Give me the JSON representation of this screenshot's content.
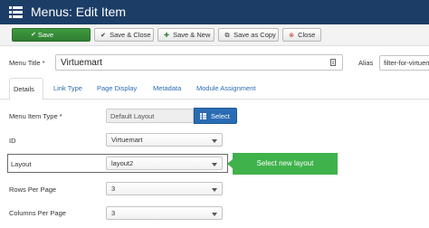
{
  "header": {
    "title": "Menus: Edit Item",
    "icon": "menu-list-icon"
  },
  "toolbar": {
    "save_label": "Save",
    "save_close_label": "Save & Close",
    "save_new_label": "Save & New",
    "save_copy_label": "Save as Copy",
    "close_label": "Close"
  },
  "form": {
    "menu_title_label": "Menu Title *",
    "menu_title_value": "Virtuemart",
    "alias_label": "Alias",
    "alias_value": "filter-for-virtuemart"
  },
  "tabs": [
    {
      "label": "Details",
      "active": true
    },
    {
      "label": "Link Type"
    },
    {
      "label": "Page Display"
    },
    {
      "label": "Metadata"
    },
    {
      "label": "Module Assignment"
    }
  ],
  "fields": {
    "menu_item_type_label": "Menu Item Type *",
    "menu_item_type_value": "Default Layout",
    "select_label": "Select",
    "id_label": "ID",
    "id_value": "Virtuemart",
    "layout_label": "Layout",
    "layout_value": "layout2",
    "rows_per_page_label": "Rows Per Page",
    "rows_per_page_value": "3",
    "columns_per_page_label": "Columns Per Page",
    "columns_per_page_value": "3"
  },
  "callout": {
    "text": "Select new layout"
  },
  "colors": {
    "header_bg": "#1b3d66",
    "save_green": "#2f7d30",
    "select_blue": "#2a6cb3",
    "callout_green": "#3fb24b",
    "link_blue": "#2a6cb3"
  }
}
